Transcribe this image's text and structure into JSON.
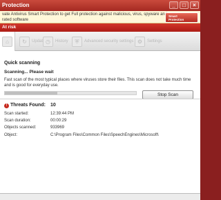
{
  "window": {
    "title": "Protection",
    "controls": [
      "_",
      "□",
      "×"
    ]
  },
  "banner": {
    "line1": "vate Antivirus Smart Protection to get Full protection against malicious, virus, spyware and",
    "line2": "rated software",
    "badge_text": "Smart\nProtection"
  },
  "status": {
    "risk_label": "At risk"
  },
  "toolbar": {
    "items": [
      {
        "label": "",
        "icon": "home-icon"
      },
      {
        "label": "Update",
        "icon": "update-icon"
      },
      {
        "label": "History",
        "icon": "history-icon"
      },
      {
        "label": "Advanced security settings",
        "icon": "shield-settings-icon"
      },
      {
        "label": "Settings",
        "icon": "gear-icon"
      }
    ]
  },
  "scan": {
    "title": "Quick scanning",
    "status": "Scanning... Please wait",
    "description": "Fast scan of the most typical places where viruses store their files. This scan does not take much time and is good for everyday use.",
    "progress": 0.4,
    "stop_label": "Stop Scan"
  },
  "results": {
    "threats_label": "Threats Found:",
    "threats_value": "10",
    "started_label": "Scan started:",
    "started_value": "12:39:44 PM",
    "duration_label": "Scan duration:",
    "duration_value": "00:00:29",
    "objects_label": "Objects scanned:",
    "objects_value": "933969",
    "object_label": "Object:",
    "object_value": "C:\\Program Files\\Common Files\\SpeechEngines\\Microsoft\\"
  },
  "colors": {
    "accent": "#c62a1f",
    "banner_bg": "#fff8d9"
  }
}
